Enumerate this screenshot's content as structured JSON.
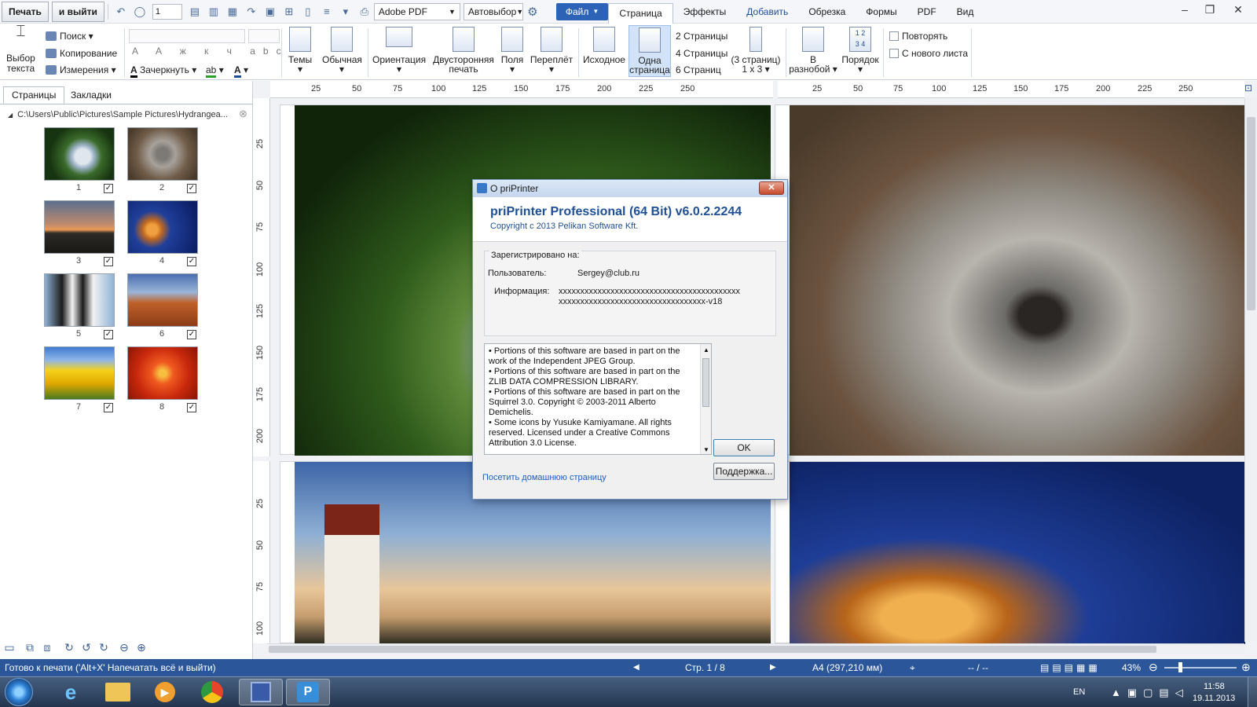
{
  "toolbar": {
    "print_label": "Печать",
    "print_exit_label": "и выйти",
    "copies_value": "1",
    "printer_name": "Adobe PDF",
    "paper_source": "Автовыбор"
  },
  "menu": {
    "file": "Файл",
    "tabs": [
      "Страница",
      "Эффекты",
      "Добавить",
      "Обрезка",
      "Формы",
      "PDF",
      "Вид"
    ]
  },
  "ribbon": {
    "select_text_l1": "Выбор",
    "select_text_l2": "текста",
    "search": "Поиск",
    "copy": "Копирование",
    "measure": "Измерения",
    "strike": "Зачеркнуть",
    "themes": "Темы",
    "normal": "Обычная",
    "orientation": "Ориентация",
    "duplex_l1": "Двусторонняя",
    "duplex_l2": "печать",
    "margins": "Поля",
    "binding": "Переплёт",
    "original": "Исходное",
    "one_page_l1": "Одна",
    "one_page_l2": "страница",
    "pages2": "2 Страницы",
    "pages4": "4 Страницы",
    "pages6": "6 Страниц",
    "pages_custom_l1": "(3 страниц)",
    "pages_custom_l2": "1 x 3",
    "scatter_l1": "В",
    "scatter_l2": "разнобой",
    "order": "Порядок",
    "repeat": "Повторять",
    "new_sheet": "С нового листа"
  },
  "left_panel": {
    "tab_pages": "Страницы",
    "tab_bookmarks": "Закладки",
    "path": "C:\\Users\\Public\\Pictures\\Sample Pictures\\Hydrangea...",
    "thumbnails": [
      {
        "num": "1",
        "checked": "✓"
      },
      {
        "num": "2",
        "checked": "✓"
      },
      {
        "num": "3",
        "checked": "✓"
      },
      {
        "num": "4",
        "checked": "✓"
      },
      {
        "num": "5",
        "checked": "✓"
      },
      {
        "num": "6",
        "checked": "✓"
      },
      {
        "num": "7",
        "checked": "✓"
      },
      {
        "num": "8",
        "checked": "✓"
      }
    ]
  },
  "rulers": {
    "h1": [
      "25",
      "50",
      "75",
      "100",
      "125",
      "150",
      "175",
      "200",
      "225",
      "250"
    ],
    "h2": [
      "25",
      "50",
      "75",
      "100",
      "125",
      "150",
      "175",
      "200",
      "225",
      "250"
    ],
    "v1": [
      "25",
      "50",
      "75",
      "100",
      "125",
      "150",
      "175",
      "200"
    ],
    "v2": [
      "25",
      "50",
      "75",
      "100"
    ]
  },
  "dialog": {
    "title": "О priPrinter",
    "product": "priPrinter Professional (64 Bit) v6.0.2.2244",
    "copyright": "Copyright c 2013 Pelikan Software Kft.",
    "registered_label": "Зарегистрировано на:",
    "user_label": "Пользователь:",
    "user_value": "Sergey@club.ru",
    "info_label": "Информация:",
    "info_line1": "xxxxxxxxxxxxxxxxxxxxxxxxxxxxxxxxxxxxxxxxxx",
    "info_line2": "xxxxxxxxxxxxxxxxxxxxxxxxxxxxxxxxxx-v18",
    "license_lines": [
      "• Portions of this software are based in part on the",
      "work of the Independent JPEG Group.",
      "• Portions of this software are based in part on the",
      "ZLIB DATA COMPRESSION LIBRARY.",
      "• Portions of this software are based in part on the",
      "Squirrel 3.0. Copyright © 2003-2011 Alberto",
      "Demichelis.",
      "• Some icons by Yusuke Kamiyamane. All rights",
      "reserved. Licensed under a Creative Commons",
      "Attribution 3.0 License."
    ],
    "ok": "OK",
    "support": "Поддержка...",
    "home_link": "Посетить домашнюю страницу"
  },
  "status": {
    "message": "Готово к печати ('Alt+X' Напечатать всё и выйти)",
    "page": "Стр. 1 / 8",
    "paper": "A4 (297,210 мм)",
    "coords": "-- / --",
    "zoom": "43%"
  },
  "taskbar": {
    "lang": "EN",
    "time": "11:58",
    "date": "19.11.2013"
  }
}
